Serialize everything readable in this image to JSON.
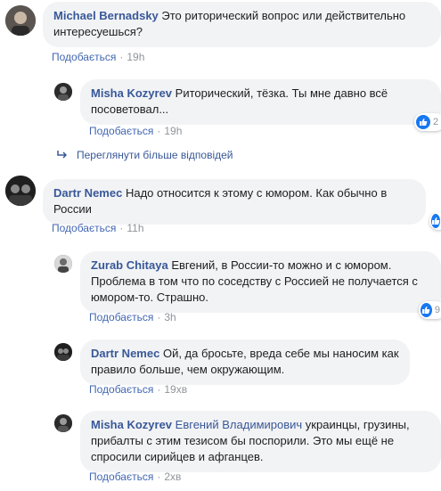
{
  "comments": [
    {
      "author": "Michael Bernadsky",
      "text": "Это риторический вопрос или действительно интересуешься?",
      "like_label": "Подобається",
      "time": "19h"
    },
    {
      "author": "Misha Kozyrev",
      "text": "Риторический, тёзка. Ты мне давно всё посоветовал...",
      "like_label": "Подобається",
      "time": "19h",
      "reaction_count": "2"
    },
    {
      "author": "Dartr Nemec",
      "text": "Надо относится к этому с юмором. Как обычно в России",
      "like_label": "Подобається",
      "time": "11h"
    },
    {
      "author": "Zurab Chitaya",
      "text": "Евгений, в России-то можно и с юмором. Проблема в том что по соседству с Россией не получается с юмором-то. Страшно.",
      "like_label": "Подобається",
      "time": "3h",
      "reaction_count": "9"
    },
    {
      "author": "Dartr Nemec",
      "text": "Ой, да бросьте, вреда себе мы наносим как правило больше, чем окружающим.",
      "like_label": "Подобається",
      "time": "19хв"
    },
    {
      "author": "Misha Kozyrev",
      "mention": "Евгений Владимирович",
      "text": " украинцы, грузины, прибалты с этим тезисом бы поспорили. Это мы ещё не спросили сирийцев и афганцев.",
      "like_label": "Подобається",
      "time": "2хв"
    }
  ],
  "more_replies_label": "Переглянути більше відповідей",
  "colors": {
    "link": "#385898",
    "bubble": "#f2f3f5",
    "meta": "#90949c",
    "like_blue": "#1877f2"
  },
  "icons": [
    "avatar",
    "like-icon",
    "reply-arrow-icon"
  ]
}
